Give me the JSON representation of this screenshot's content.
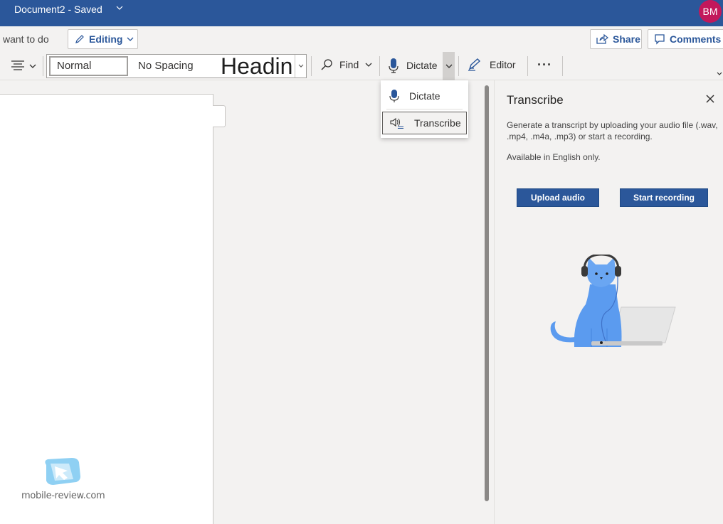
{
  "titlebar": {
    "document_title": "Document2",
    "separator": "-",
    "save_status": "Saved",
    "avatar_initials": "BM",
    "bg_color": "#2b579a"
  },
  "command_bar": {
    "tell_me": "want to do",
    "editing_label": "Editing",
    "share_label": "Share",
    "comments_label": "Comments"
  },
  "ribbon": {
    "styles": {
      "normal": "Normal",
      "no_spacing": "No Spacing",
      "heading": "Headin"
    },
    "find_label": "Find",
    "dictate_label": "Dictate",
    "editor_label": "Editor",
    "more_label": "···"
  },
  "dictate_menu": {
    "items": [
      {
        "label": "Dictate",
        "icon": "microphone-icon"
      },
      {
        "label": "Transcribe",
        "icon": "transcribe-icon"
      }
    ]
  },
  "transcribe_pane": {
    "title": "Transcribe",
    "description": "Generate a transcript by uploading your audio file (.wav, .mp4, .m4a, .mp3) or start a recording.",
    "availability": "Available in English only.",
    "upload_button": "Upload audio",
    "record_button": "Start recording"
  },
  "watermark": {
    "text": "mobile-review.com"
  },
  "colors": {
    "accent": "#2b579a",
    "avatar": "#c2185b",
    "illustration_cat": "#5b9bef"
  }
}
